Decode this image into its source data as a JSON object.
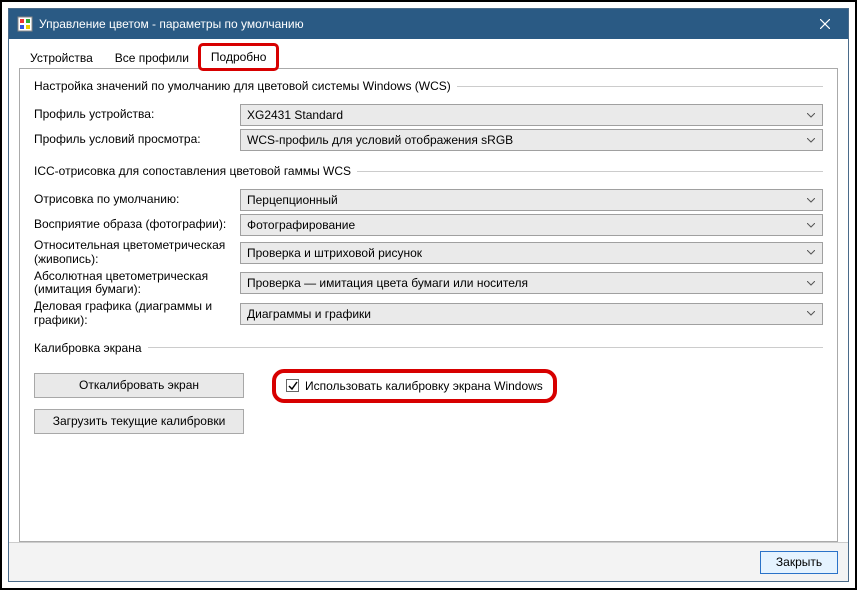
{
  "window": {
    "title": "Управление цветом - параметры по умолчанию"
  },
  "tabs": {
    "devices": "Устройства",
    "all_profiles": "Все профили",
    "advanced": "Подробно"
  },
  "group_wcs": {
    "title": "Настройка значений по умолчанию для цветовой системы Windows (WCS)",
    "device_profile_label": "Профиль устройства:",
    "device_profile_value": "XG2431 Standard",
    "viewing_profile_label": "Профиль условий просмотра:",
    "viewing_profile_value": "WCS-профиль для условий отображения sRGB"
  },
  "group_icc": {
    "title": "ICC-отрисовка для сопоставления цветовой гаммы WCS",
    "rows": {
      "default_render": {
        "label": "Отрисовка по умолчанию:",
        "value": "Перцепционный"
      },
      "photo": {
        "label": "Восприятие образа (фотографии):",
        "value": "Фотографирование"
      },
      "relative": {
        "label": "Относительная цветометрическая (живопись):",
        "value": "Проверка и штриховой рисунок"
      },
      "absolute": {
        "label": "Абсолютная цветометрическая (имитация бумаги):",
        "value": "Проверка — имитация цвета бумаги или носителя"
      },
      "business": {
        "label": "Деловая графика (диаграммы и графики):",
        "value": "Диаграммы и графики"
      }
    }
  },
  "group_calib": {
    "title": "Калибровка экрана",
    "calibrate_button": "Откалибровать экран",
    "load_button": "Загрузить текущие калибровки",
    "use_windows_calib": "Использовать калибровку экрана Windows"
  },
  "footer": {
    "close": "Закрыть"
  }
}
